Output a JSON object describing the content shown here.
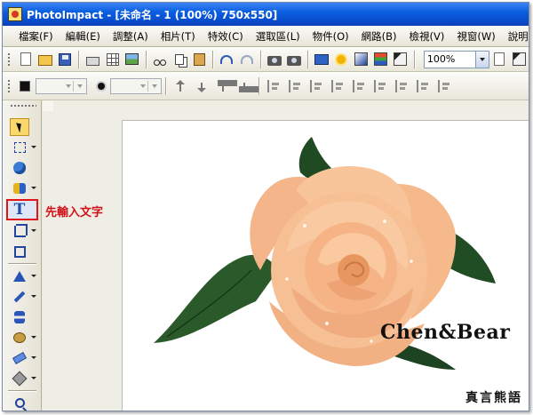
{
  "window": {
    "title": "PhotoImpact - [未命名 - 1 (100%) 750x550]"
  },
  "menu": {
    "items": [
      {
        "label": "檔案(F)"
      },
      {
        "label": "編輯(E)"
      },
      {
        "label": "調整(A)"
      },
      {
        "label": "相片(T)"
      },
      {
        "label": "特效(C)"
      },
      {
        "label": "選取區(L)"
      },
      {
        "label": "物件(O)"
      },
      {
        "label": "網路(B)"
      },
      {
        "label": "檢視(V)"
      },
      {
        "label": "視窗(W)"
      },
      {
        "label": "說明(H)"
      }
    ]
  },
  "toolbar": {
    "zoom_value": "100%",
    "icons": [
      "new-icon",
      "open-icon",
      "save-icon",
      "print-icon",
      "grid-icon",
      "photo-icon",
      "cut-icon",
      "copy-icon",
      "paste-icon",
      "undo-icon",
      "redo-icon",
      "camera-icon",
      "scanner-icon",
      "monitor-icon",
      "sun-icon",
      "gradient-icon",
      "effect-icon",
      "brush-icon"
    ]
  },
  "toolbox": {
    "icons": [
      "pointer-icon",
      "marquee-icon",
      "circles-icon",
      "shapes-icon",
      "text-icon",
      "crop-icon",
      "transform-icon",
      "triangle-icon",
      "pen-icon",
      "stamp-icon",
      "retouch-icon",
      "eraser-icon",
      "bucket-icon",
      "zoom-icon"
    ],
    "text_tool_glyph": "T",
    "highlight_color": "#e0141b"
  },
  "annotation": {
    "text": "先輸入文字",
    "color": "#d01218"
  },
  "canvas": {
    "brand_text": "Chen&Bear",
    "signature_text": "真言熊語"
  },
  "colors": {
    "titlebar": "#0a5fe0",
    "rose_petal": "#f6b98a",
    "leaf": "#1f4a22"
  }
}
